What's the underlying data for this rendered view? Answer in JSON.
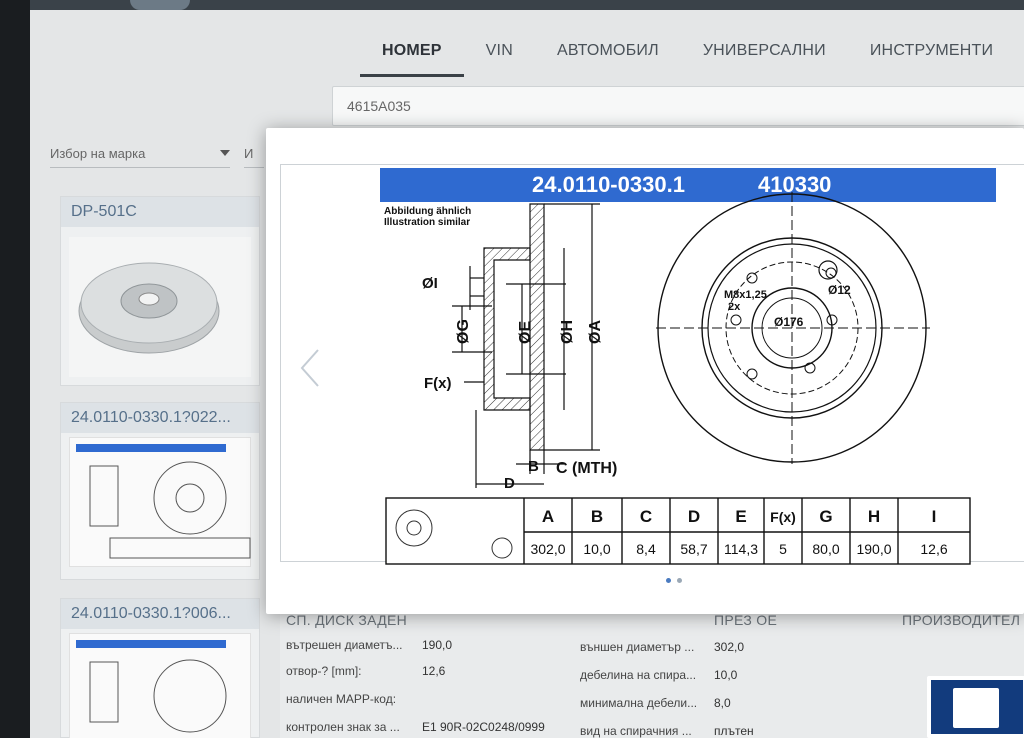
{
  "nav": {
    "tabs": [
      "НОМЕР",
      "VIN",
      "АВТОМОБИЛ",
      "УНИВЕРСАЛНИ",
      "ИНСТРУМЕНТИ"
    ]
  },
  "search": {
    "value": "4615A035"
  },
  "filters": {
    "brand_placeholder": "Избор на марка",
    "second_stub": "И"
  },
  "cards": [
    {
      "title": "DP-501C"
    },
    {
      "title": "24.0110-0330.1?022..."
    },
    {
      "title": "24.0110-0330.1?006..."
    }
  ],
  "drawing": {
    "part_no": "24.0110-0330.1",
    "ref_no": "410330",
    "note1": "Abbildung ähnlich",
    "note2": "Illustration similar",
    "dim_labels": [
      "ØI",
      "ØG",
      "ØE",
      "ØH",
      "ØA",
      "F(x)",
      "B",
      "C (MTH)",
      "D"
    ],
    "front_labels": {
      "bolt": "M8x1,25",
      "bolt_count": "2x",
      "hole": "Ø12",
      "pcd": "Ø176"
    },
    "table_headers": [
      "A",
      "B",
      "C",
      "D",
      "E",
      "F(x)",
      "G",
      "H",
      "I"
    ],
    "table_values": [
      "302,0",
      "10,0",
      "8,4",
      "58,7",
      "114,3",
      "5",
      "80,0",
      "190,0",
      "12,6"
    ]
  },
  "details": {
    "left_header": "СП. ДИСК ЗАДЕН",
    "mid_header": "ПРЕЗ ОЕ",
    "right_header": "ПРОИЗВОДИТЕЛ",
    "left_rows": [
      {
        "label": "вътрешен диаметъ...",
        "value": "190,0"
      },
      {
        "label": "отвор-? [mm]:",
        "value": "12,6"
      },
      {
        "label": "наличен МАРР-код:",
        "value": ""
      },
      {
        "label": "контролен знак за ...",
        "value": "E1 90R-02C0248/0999"
      }
    ],
    "right_rows": [
      {
        "label": "външен диаметър ...",
        "value": "302,0"
      },
      {
        "label": "дебелина на спира...",
        "value": "10,0"
      },
      {
        "label": "минимална дебели...",
        "value": "8,0"
      },
      {
        "label": "вид на спирачния ...",
        "value": "плътен"
      }
    ]
  },
  "colors": {
    "accent": "#2f6ad0",
    "ate_blue": "#123b7d"
  }
}
